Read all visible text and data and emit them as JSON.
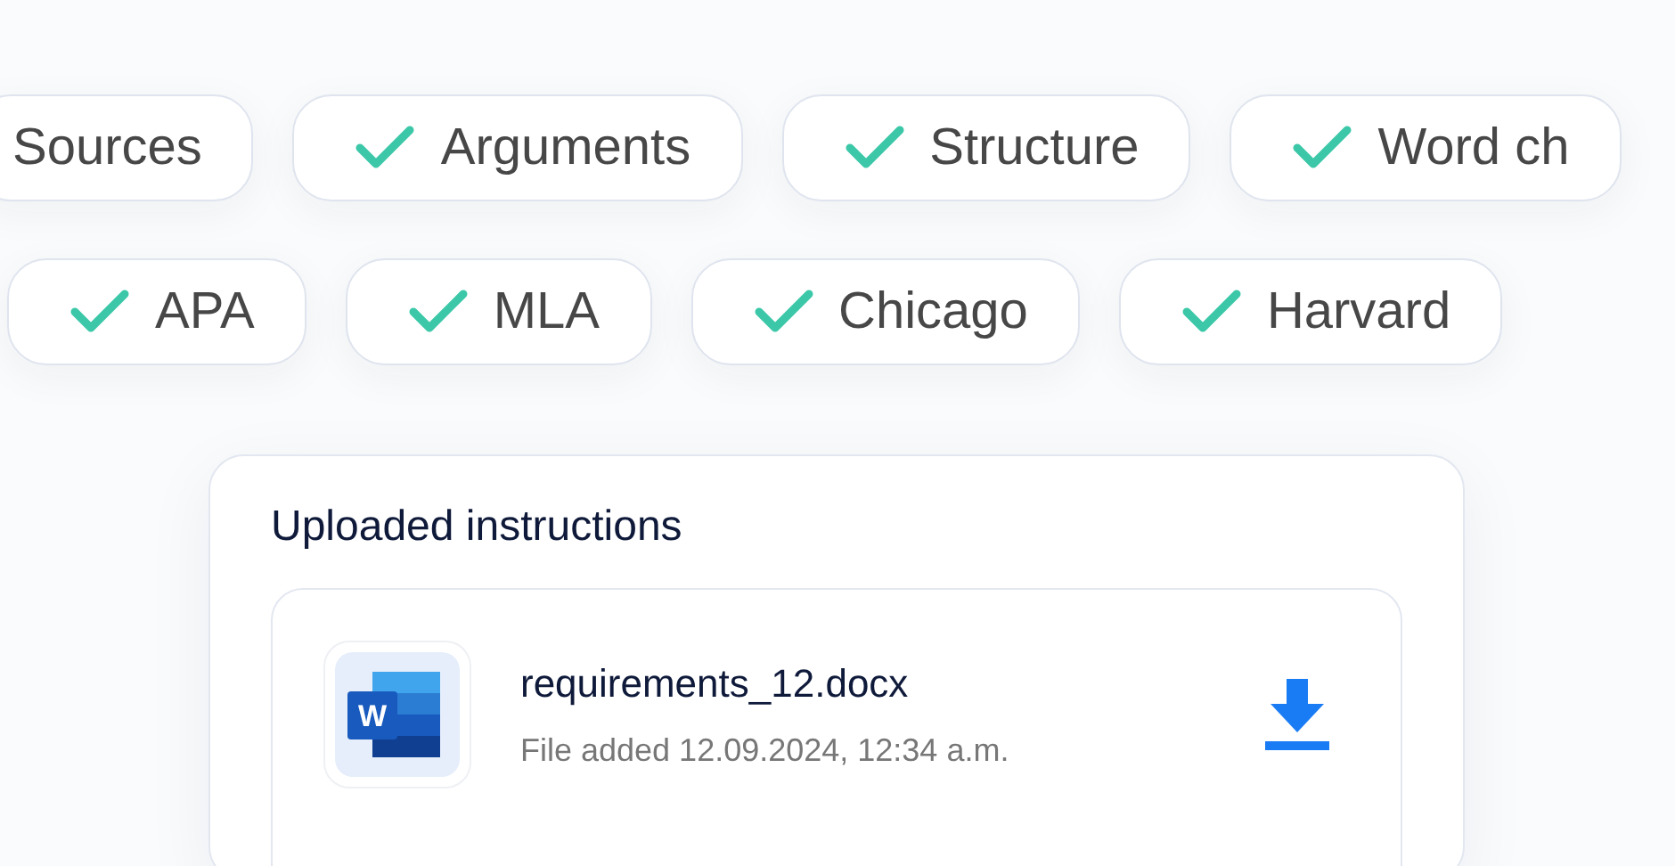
{
  "tag_rows": [
    {
      "chips": [
        {
          "label": "Sources"
        },
        {
          "label": "Arguments",
          "checked": true
        },
        {
          "label": "Structure",
          "checked": true
        },
        {
          "label": "Word ch",
          "checked": true
        }
      ]
    },
    {
      "chips": [
        {
          "label": "APA",
          "checked": true
        },
        {
          "label": "MLA",
          "checked": true
        },
        {
          "label": "Chicago",
          "checked": true
        },
        {
          "label": "Harvard",
          "checked": true
        }
      ]
    }
  ],
  "uploads": {
    "title": "Uploaded instructions",
    "files": [
      {
        "name": "requirements_12.docx",
        "added": "File added 12.09.2024, 12:34 a.m.",
        "icon_letter": "W"
      }
    ]
  }
}
